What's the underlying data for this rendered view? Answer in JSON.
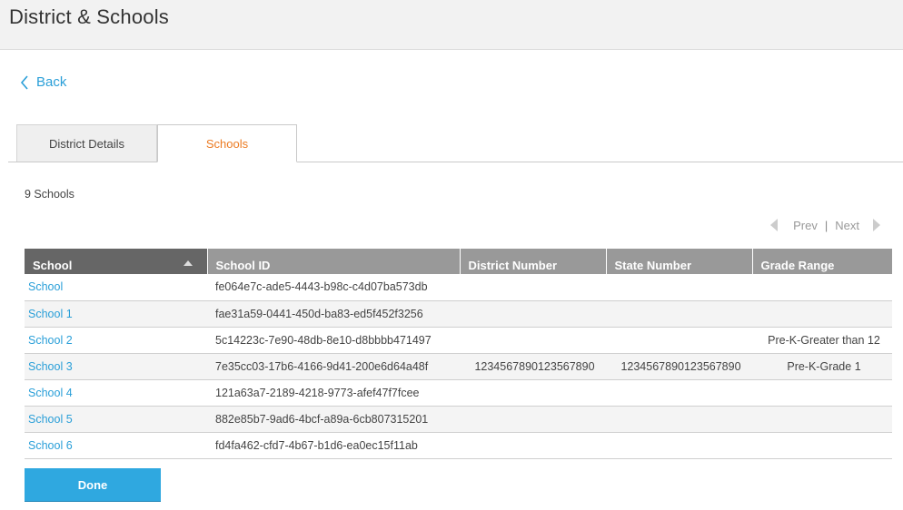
{
  "header": {
    "title": "District & Schools"
  },
  "nav": {
    "back_label": "Back"
  },
  "tabs": [
    {
      "label": "District Details",
      "active": false
    },
    {
      "label": "Schools",
      "active": true
    }
  ],
  "summary": {
    "count_text": "9 Schools"
  },
  "pager": {
    "prev_label": "Prev",
    "separator": "|",
    "next_label": "Next"
  },
  "table": {
    "columns": [
      "School",
      "School ID",
      "District Number",
      "State Number",
      "Grade Range"
    ],
    "sort": {
      "column": "School",
      "direction": "ascending"
    },
    "rows": [
      {
        "school": "School",
        "school_id": "fe064e7c-ade5-4443-b98c-c4d07ba573db",
        "district_number": "",
        "state_number": "",
        "grade_range": ""
      },
      {
        "school": "School 1",
        "school_id": "fae31a59-0441-450d-ba83-ed5f452f3256",
        "district_number": "",
        "state_number": "",
        "grade_range": ""
      },
      {
        "school": "School 2",
        "school_id": "5c14223c-7e90-48db-8e10-d8bbbb471497",
        "district_number": "",
        "state_number": "",
        "grade_range": "Pre-K-Greater than 12"
      },
      {
        "school": "School 3",
        "school_id": "7e35cc03-17b6-4166-9d41-200e6d64a48f",
        "district_number": "1234567890123567890",
        "state_number": "1234567890123567890",
        "grade_range": "Pre-K-Grade 1"
      },
      {
        "school": "School 4",
        "school_id": "121a63a7-2189-4218-9773-afef47f7fcee",
        "district_number": "",
        "state_number": "",
        "grade_range": ""
      },
      {
        "school": "School 5",
        "school_id": "882e85b7-9ad6-4bcf-a89a-6cb807315201",
        "district_number": "",
        "state_number": "",
        "grade_range": ""
      },
      {
        "school": "School 6",
        "school_id": "fd4fa462-cfd7-4b67-b1d6-ea0ec15f11ab",
        "district_number": "",
        "state_number": "",
        "grade_range": ""
      }
    ]
  },
  "actions": {
    "done_label": "Done"
  },
  "colors": {
    "accent_link": "#2a9fd8",
    "active_tab": "#ec7b22",
    "button": "#2fa8e0",
    "header_bg": "#999999",
    "sorted_header_bg": "#666666"
  }
}
